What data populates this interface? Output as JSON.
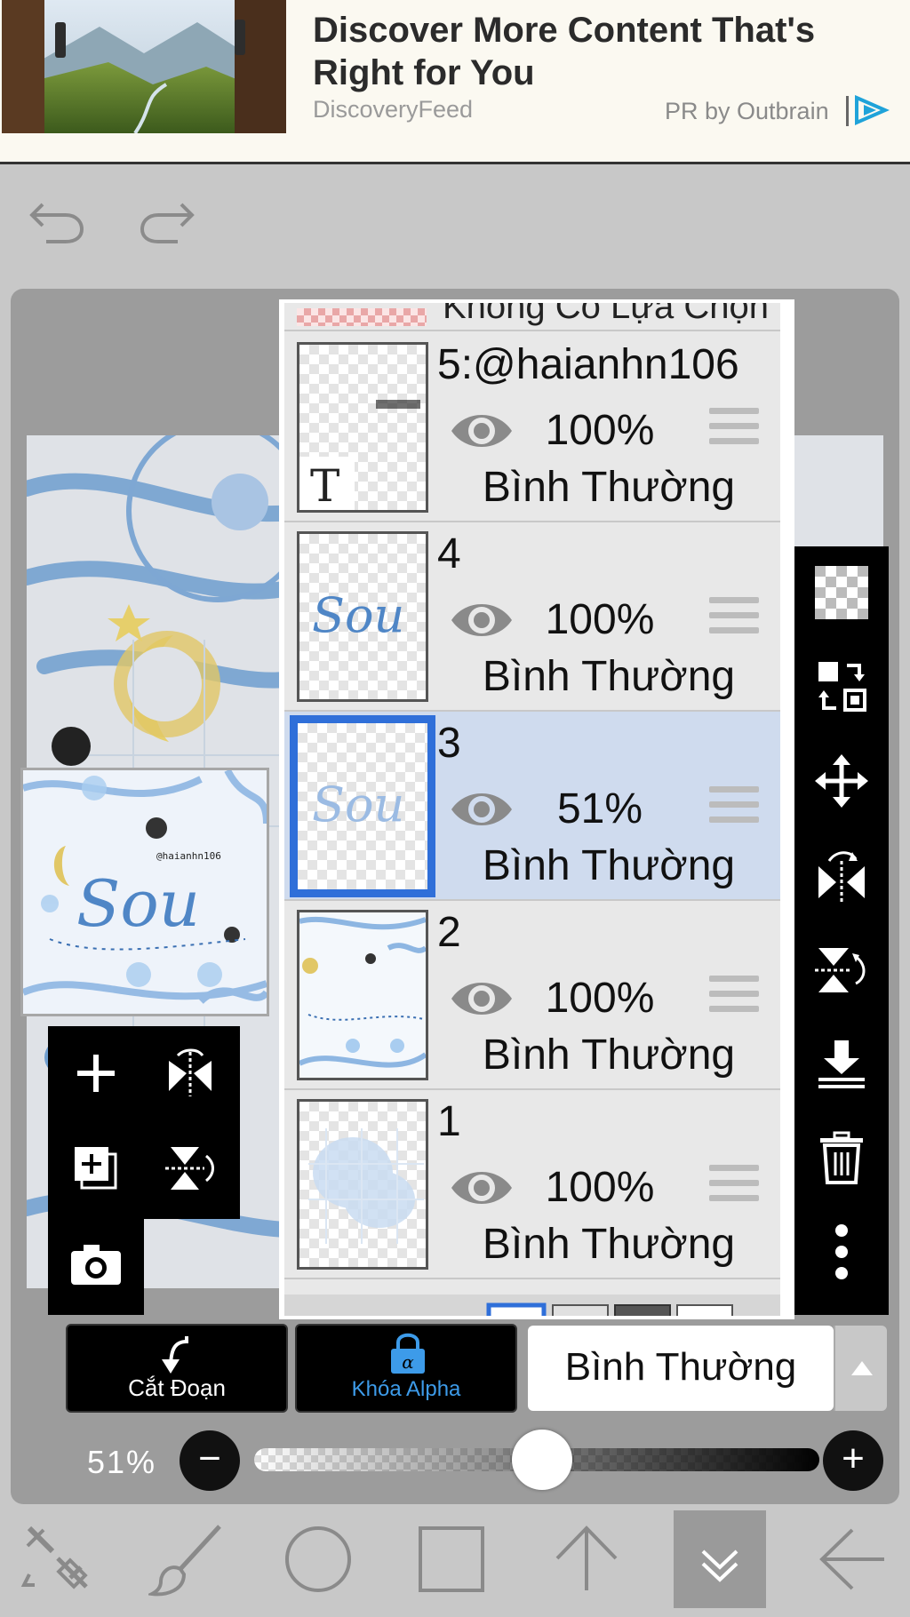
{
  "ad": {
    "title": "Discover More Content That's Right for You",
    "source": "DiscoveryFeed",
    "pr_text": "PR by Outbrain"
  },
  "toolbar_top": {
    "undo_icon": "undo-icon",
    "redo_icon": "redo-icon"
  },
  "layers_panel": {
    "selection_header": "Không Có Lựa Chọn",
    "layers": [
      {
        "name": "5:@haianhn106",
        "opacity": "100%",
        "blend": "Bình Thường",
        "visible": true,
        "selected": false,
        "type": "text"
      },
      {
        "name": "4",
        "opacity": "100%",
        "blend": "Bình Thường",
        "visible": true,
        "selected": false,
        "type": "image"
      },
      {
        "name": "3",
        "opacity": "51%",
        "blend": "Bình Thường",
        "visible": true,
        "selected": true,
        "type": "image"
      },
      {
        "name": "2",
        "opacity": "100%",
        "blend": "Bình Thường",
        "visible": true,
        "selected": false,
        "type": "image"
      },
      {
        "name": "1",
        "opacity": "100%",
        "blend": "Bình Thường",
        "visible": true,
        "selected": false,
        "type": "image"
      }
    ],
    "thumb_text_glyph": "T",
    "thumb_script_text": "Sou"
  },
  "preview": {
    "script_text": "Sou",
    "credit": "@haianhn106"
  },
  "actions": {
    "clip_label": "Cắt Đoạn",
    "alpha_lock_label": "Khóa Alpha",
    "blend_mode_value": "Bình Thường"
  },
  "opacity": {
    "label": "51%",
    "value": 0.51
  },
  "colors": {
    "accent": "#2f6fd9",
    "alpha_lock": "#3d9be9",
    "selected_row": "#cfdbee"
  }
}
